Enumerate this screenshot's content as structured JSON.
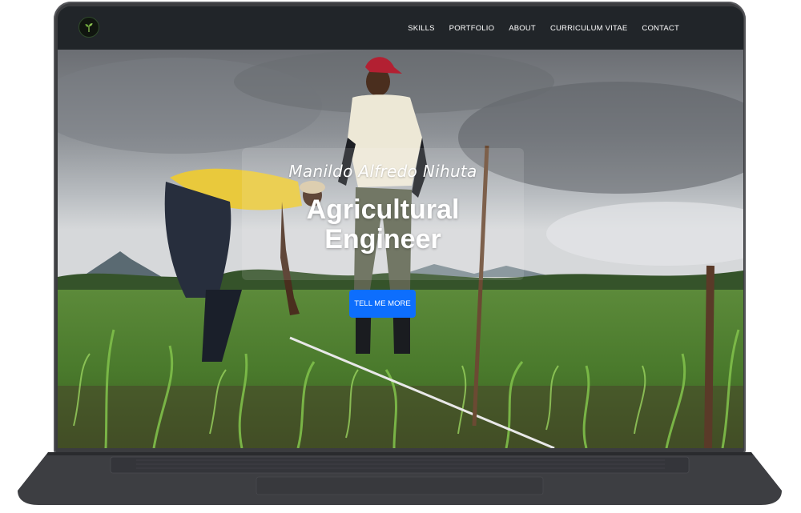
{
  "nav": {
    "logo_icon": "sprout-logo-icon",
    "links": [
      {
        "label": "SKILLS"
      },
      {
        "label": "PORTFOLIO"
      },
      {
        "label": "ABOUT"
      },
      {
        "label": "CURRICULUM VITAE"
      },
      {
        "label": "CONTACT"
      }
    ]
  },
  "hero": {
    "name": "Manildo Alfredo Nihuta",
    "title_line1": "Agricultural",
    "title_line2": "Engineer",
    "cta_label": "TELL ME MORE",
    "image": "field-workers-photo"
  },
  "colors": {
    "navbar_bg": "#212529",
    "cta_bg": "#0d6efd",
    "text": "#ffffff"
  }
}
